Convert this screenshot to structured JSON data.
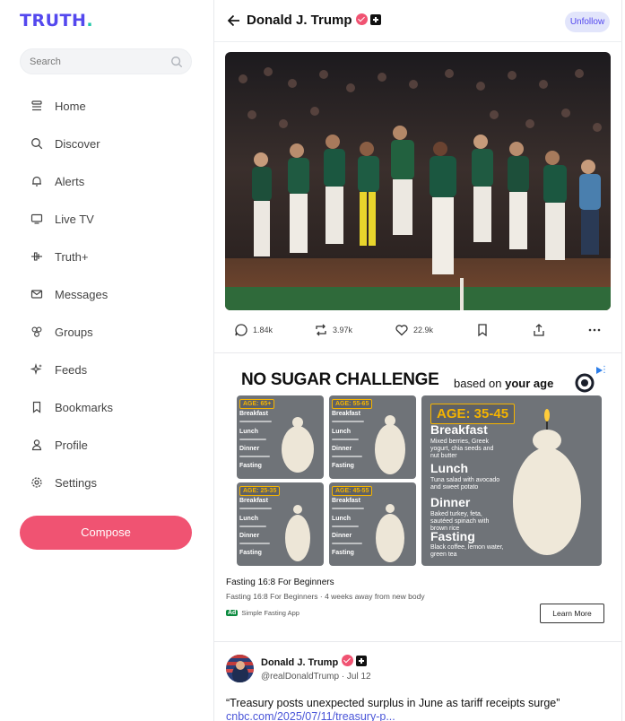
{
  "brand": {
    "logo": "TRUTH",
    "logo_dot": "."
  },
  "search": {
    "placeholder": "Search"
  },
  "nav": {
    "items": [
      {
        "label": "Home",
        "icon": "home-icon"
      },
      {
        "label": "Discover",
        "icon": "search-icon"
      },
      {
        "label": "Alerts",
        "icon": "bell-icon"
      },
      {
        "label": "Live TV",
        "icon": "tv-icon"
      },
      {
        "label": "Truth+",
        "icon": "truth-plus-icon"
      },
      {
        "label": "Messages",
        "icon": "envelope-icon"
      },
      {
        "label": "Groups",
        "icon": "groups-icon"
      },
      {
        "label": "Feeds",
        "icon": "sparkle-icon"
      },
      {
        "label": "Bookmarks",
        "icon": "bookmark-icon"
      },
      {
        "label": "Profile",
        "icon": "user-icon"
      },
      {
        "label": "Settings",
        "icon": "gear-icon"
      }
    ],
    "compose": "Compose"
  },
  "header": {
    "name": "Donald J. Trump",
    "unfollow": "Unfollow"
  },
  "post": {
    "actions": {
      "replies": "1.84k",
      "retruths": "3.97k",
      "likes": "22.9k"
    }
  },
  "ad": {
    "title": "NO SUGAR CHALLENGE",
    "subtitle_prefix": "based on ",
    "subtitle_bold": "your age",
    "tiles": [
      {
        "age": "AGE: 65+",
        "l1": "Breakfast",
        "l2": "Lunch",
        "l3": "Dinner",
        "l4": "Fasting"
      },
      {
        "age": "AGE: 55-65",
        "l1": "Breakfast",
        "l2": "Lunch",
        "l3": "Dinner",
        "l4": "Fasting"
      },
      {
        "age": "AGE: 25-35",
        "l1": "Breakfast",
        "l2": "Lunch",
        "l3": "Dinner",
        "l4": "Fasting"
      },
      {
        "age": "AGE: 45-55",
        "l1": "Breakfast",
        "l2": "Lunch",
        "l3": "Dinner",
        "l4": "Fasting"
      }
    ],
    "big": {
      "age": "AGE: 35-45",
      "breakfast": "Breakfast",
      "breakfast_txt": "Mixed berries, Greek yogurt, chia seeds and nut butter",
      "lunch": "Lunch",
      "lunch_txt": "Tuna salad with avocado and sweet potato",
      "dinner": "Dinner",
      "dinner_txt": "Baked turkey, feta, sautéed spinach with brown rice",
      "fasting": "Fasting",
      "fasting_txt": "Black coffee, lemon water, green tea"
    },
    "headline": "Fasting 16:8 For Beginners",
    "description": "Fasting 16:8 For Beginners · 4 weeks away from new body",
    "tag": "Ad",
    "advertiser": "Simple Fasting App",
    "cta": "Learn More"
  },
  "post2": {
    "name": "Donald J. Trump",
    "handle": "@realDonaldTrump",
    "date": " · Jul 12",
    "text": "“Treasury posts unexpected surplus in June as tariff receipts surge”",
    "link": "cnbc.com/2025/07/11/treasury-p..."
  },
  "colors": {
    "brand": "#5448ee",
    "accent": "#f05372",
    "teal": "#20c7a8",
    "link": "#4a55d8"
  }
}
